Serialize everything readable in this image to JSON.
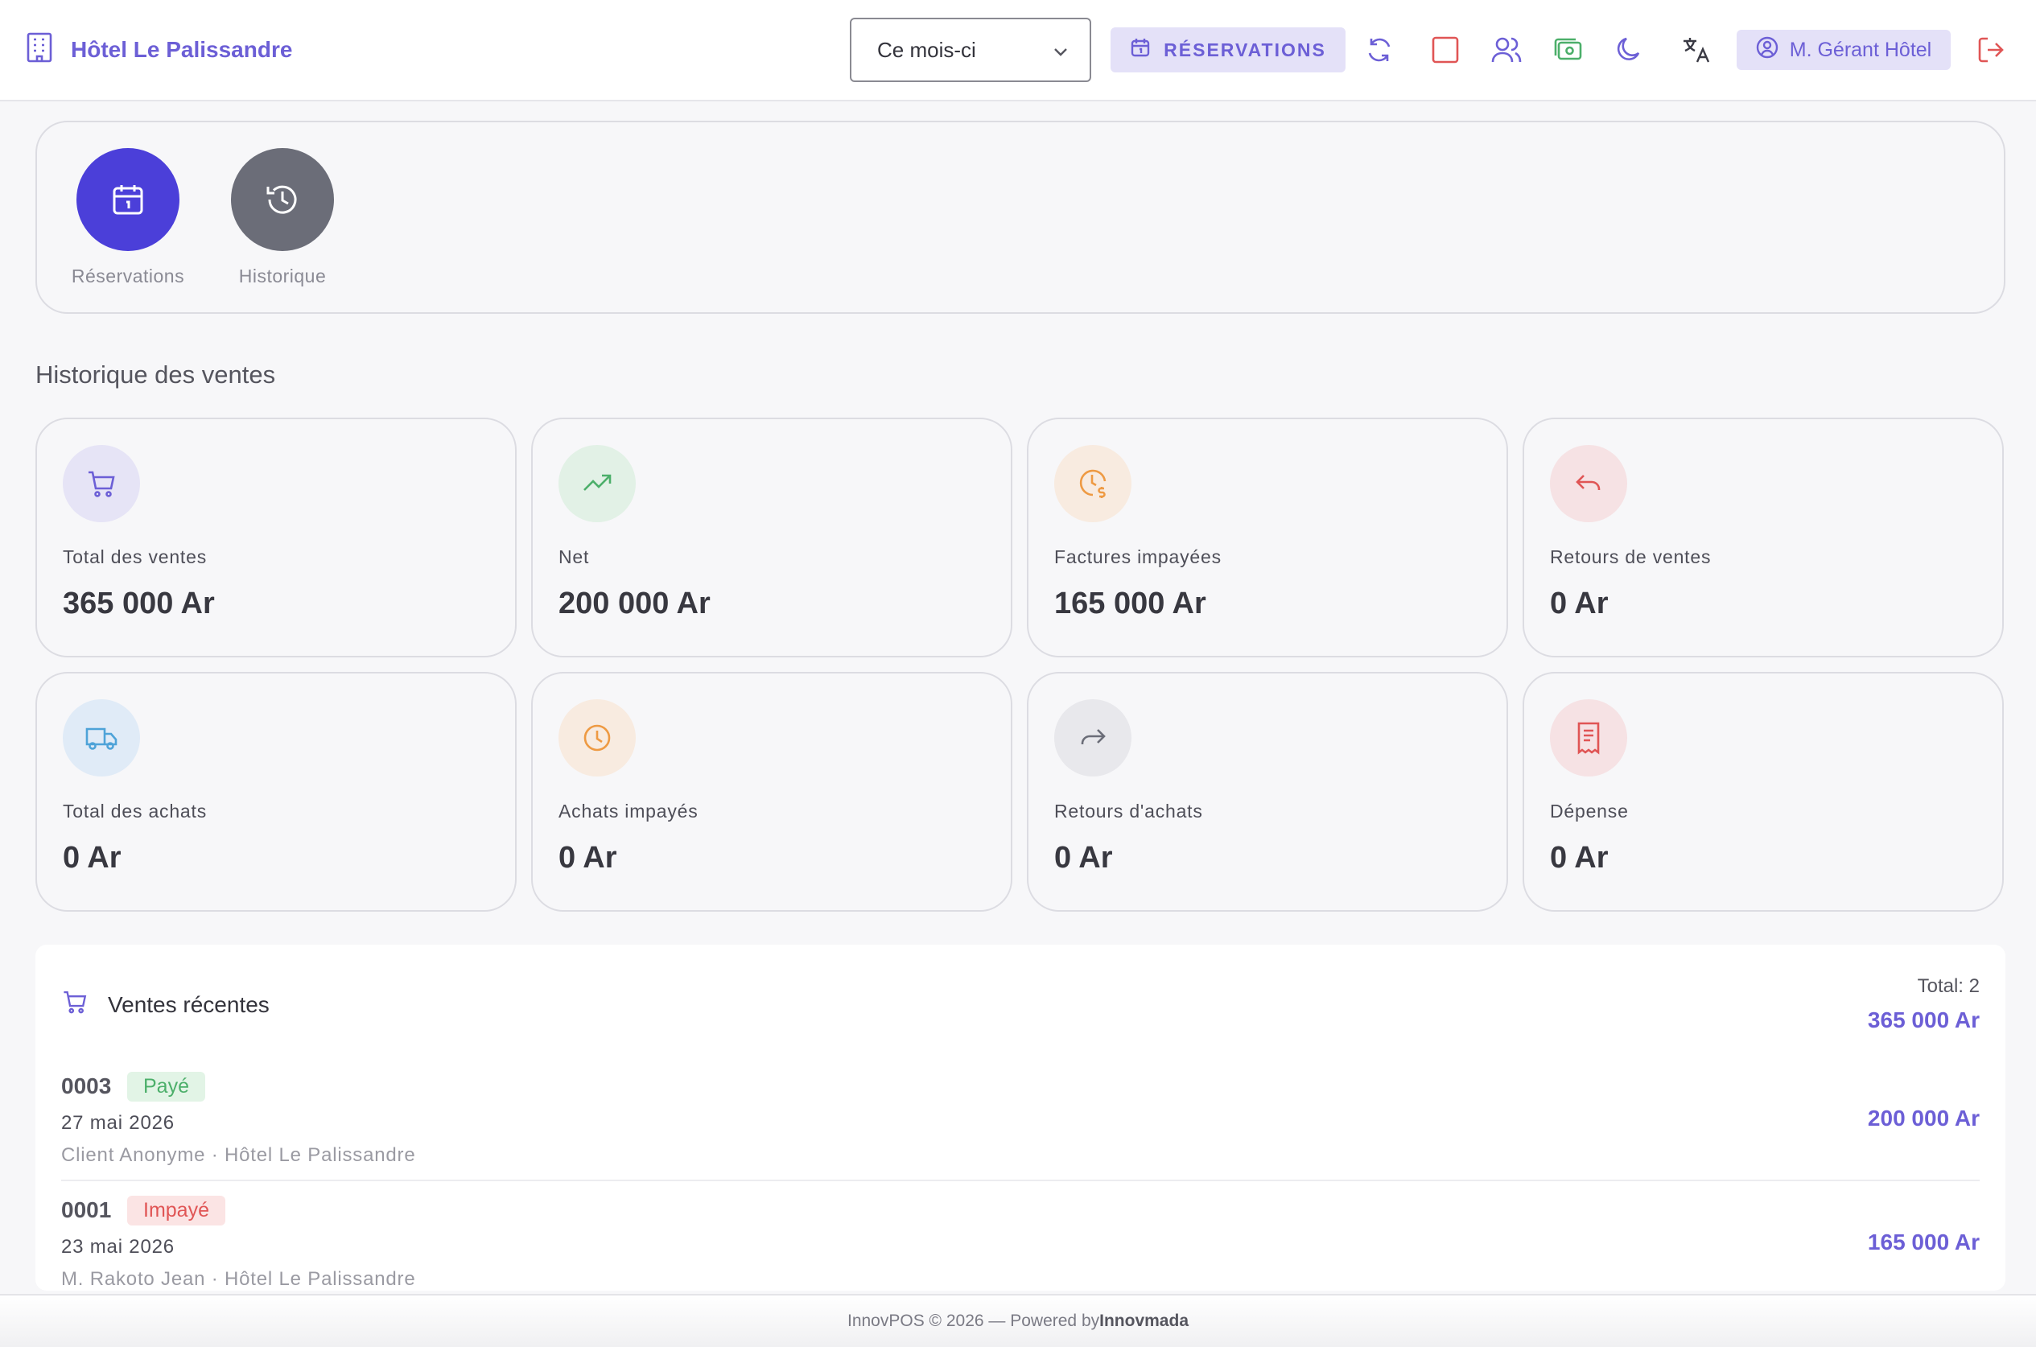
{
  "header": {
    "brand_name": "Hôtel Le Palissandre",
    "period_value": "Ce mois-ci",
    "reservations_button": "RÉSERVATIONS",
    "user_name": "M. Gérant Hôtel"
  },
  "quick_actions": [
    {
      "label": "Réservations",
      "icon": "calendar-icon",
      "color": "#4b3fd9"
    },
    {
      "label": "Historique",
      "icon": "history-icon",
      "color": "#6b6d78"
    }
  ],
  "section_title": "Historique des ventes",
  "stats": [
    {
      "label": "Total des ventes",
      "value": "365 000 Ar",
      "icon": "cart-icon"
    },
    {
      "label": "Net",
      "value": "200 000 Ar",
      "icon": "trending-up-icon"
    },
    {
      "label": "Factures impayées",
      "value": "165 000 Ar",
      "icon": "clock-dollar-icon"
    },
    {
      "label": "Retours de ventes",
      "value": "0 Ar",
      "icon": "return-left-icon"
    },
    {
      "label": "Total des achats",
      "value": "0 Ar",
      "icon": "truck-icon"
    },
    {
      "label": "Achats impayés",
      "value": "0 Ar",
      "icon": "clock-icon"
    },
    {
      "label": "Retours d'achats",
      "value": "0 Ar",
      "icon": "forward-icon"
    },
    {
      "label": "Dépense",
      "value": "0 Ar",
      "icon": "receipt-icon"
    }
  ],
  "recent_sales": {
    "title": "Ventes récentes",
    "total_label": "Total: 2",
    "total_amount": "365 000 Ar",
    "items": [
      {
        "number": "0003",
        "status": "Payé",
        "date": "27 mai 2026",
        "client": "Client Anonyme · Hôtel Le Palissandre",
        "amount": "200 000 Ar"
      },
      {
        "number": "0001",
        "status": "Impayé",
        "date": "23 mai 2026",
        "client": "M. Rakoto Jean · Hôtel Le Palissandre",
        "amount": "165 000 Ar"
      }
    ]
  },
  "footer": {
    "text": "InnovPOS © 2026 — Powered by",
    "company": "Innovmada"
  },
  "colors": {
    "accent": "#6c5fd6",
    "paid": "#4caf6a",
    "unpaid": "#e05555"
  }
}
